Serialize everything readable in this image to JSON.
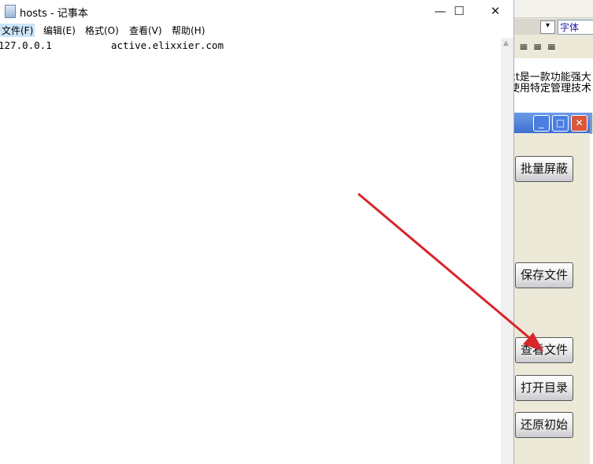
{
  "notepad": {
    "title": "hosts - 记事本",
    "menu": [
      "文件(F)",
      "编辑(E)",
      "格式(O)",
      "查看(V)",
      "帮助(H)"
    ],
    "content": "127.0.0.1          active.elixxier.com",
    "controls": {
      "minimize": "—",
      "maximize": "☐",
      "close": "✕"
    }
  },
  "background_app": {
    "font_box": "字体",
    "align_icons": "≡≡≡ ⋮≡",
    "text_lines": [
      "xt是一款功能强大",
      "使用特定管理技术"
    ],
    "dialog": {
      "buttons": [
        "批量屏蔽",
        "保存文件",
        "查看文件",
        "打开目录",
        "还原初始"
      ]
    }
  },
  "annotation": {
    "arrow_color": "#d9262b"
  }
}
